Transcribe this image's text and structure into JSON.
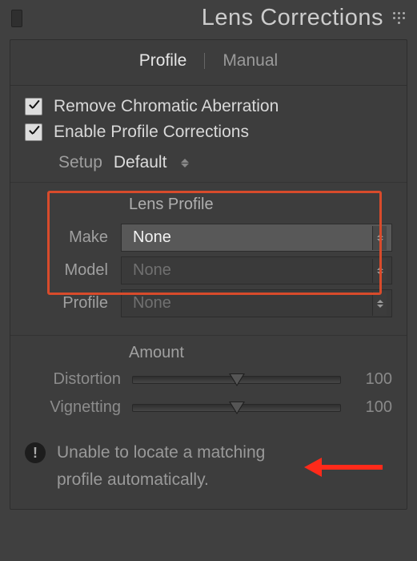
{
  "panel": {
    "title": "Lens Corrections"
  },
  "tabs": {
    "profile": "Profile",
    "manual": "Manual",
    "active": "profile"
  },
  "checks": {
    "chromatic": "Remove Chromatic Aberration",
    "enable_profile": "Enable Profile Corrections"
  },
  "setup": {
    "label": "Setup",
    "value": "Default"
  },
  "lens_profile": {
    "section_label": "Lens Profile",
    "make_label": "Make",
    "make_value": "None",
    "model_label": "Model",
    "model_value": "None",
    "profile_label": "Profile",
    "profile_value": "None"
  },
  "amount": {
    "section_label": "Amount",
    "distortion_label": "Distortion",
    "distortion_value": "100",
    "vignetting_label": "Vignetting",
    "vignetting_value": "100"
  },
  "warning": {
    "text": "Unable to locate a matching profile automatically."
  }
}
